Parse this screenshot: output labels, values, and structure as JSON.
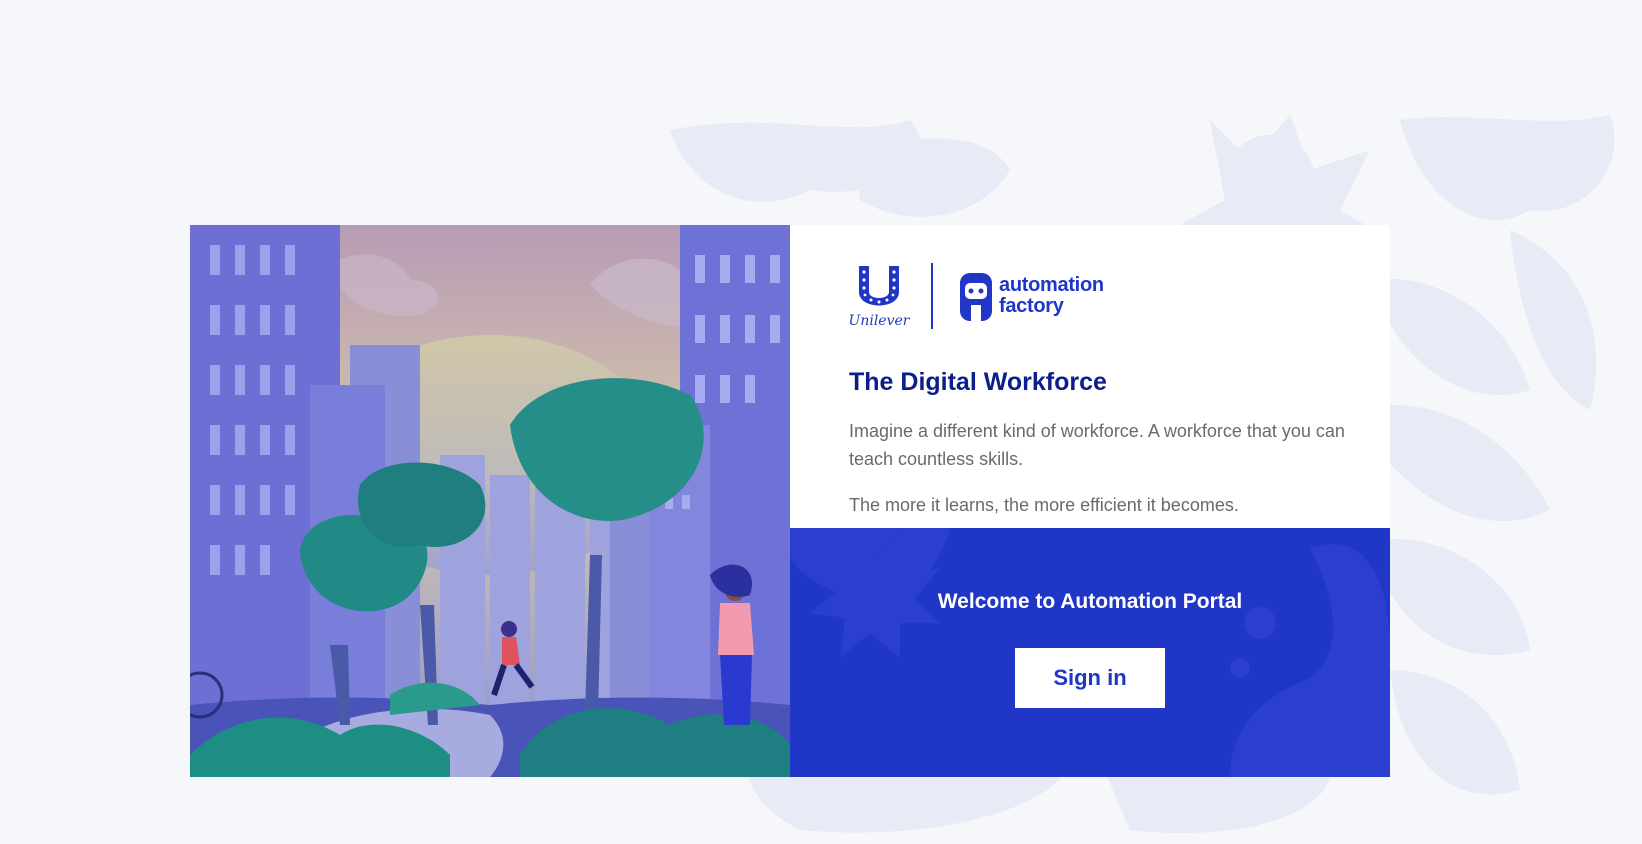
{
  "brand": {
    "unilever_word": "Unilever",
    "automation_factory_line1": "automation",
    "automation_factory_line2": "factory"
  },
  "intro": {
    "title": "The Digital Workforce",
    "paragraph1": "Imagine a different kind of workforce. A workforce that you can teach countless skills.",
    "paragraph2": "The more it learns, the more efficient it becomes."
  },
  "login": {
    "welcome": "Welcome to Automation Portal",
    "sign_in_label": "Sign in"
  },
  "colors": {
    "brand_blue": "#1f36c7",
    "title_navy": "#0b1e8a",
    "page_bg": "#f6f7fb"
  }
}
